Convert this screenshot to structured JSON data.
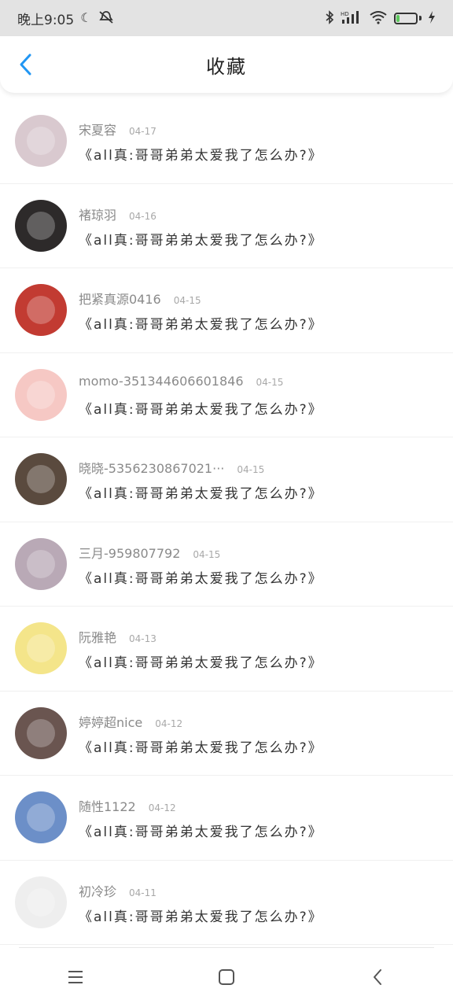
{
  "statusbar": {
    "time": "晚上9:05",
    "icons": [
      "moon-icon",
      "mute-icon",
      "bluetooth-icon",
      "hd-signal-icon",
      "wifi-icon",
      "battery-icon",
      "charging-icon"
    ],
    "battery_level": "16"
  },
  "header": {
    "title": "收藏",
    "back_icon": "chevron-left-icon"
  },
  "items": [
    {
      "name": "宋夏容",
      "date": "04-17",
      "snippet": "《all真:哥哥弟弟太爱我了怎么办?》",
      "avatar_color": "#d9c9cf"
    },
    {
      "name": "褚琼羽",
      "date": "04-16",
      "snippet": "《all真:哥哥弟弟太爱我了怎么办?》",
      "avatar_color": "#2d2a2a"
    },
    {
      "name": "把紧真源0416",
      "date": "04-15",
      "snippet": "《all真:哥哥弟弟太爱我了怎么办?》",
      "avatar_color": "#c23b32"
    },
    {
      "name": "momo-351344606601846",
      "date": "04-15",
      "snippet": "《all真:哥哥弟弟太爱我了怎么办?》",
      "avatar_color": "#f6c8c4"
    },
    {
      "name": "晓晓-5356230867021···",
      "date": "04-15",
      "snippet": "《all真:哥哥弟弟太爱我了怎么办?》",
      "avatar_color": "#5a4a3e"
    },
    {
      "name": "三月-959807792",
      "date": "04-15",
      "snippet": "《all真:哥哥弟弟太爱我了怎么办?》",
      "avatar_color": "#b9a9b6"
    },
    {
      "name": "阮雅艳",
      "date": "04-13",
      "snippet": "《all真:哥哥弟弟太爱我了怎么办?》",
      "avatar_color": "#f4e58a"
    },
    {
      "name": "婷婷超nice",
      "date": "04-12",
      "snippet": "《all真:哥哥弟弟太爱我了怎么办?》",
      "avatar_color": "#6a5550"
    },
    {
      "name": "随性1122",
      "date": "04-12",
      "snippet": "《all真:哥哥弟弟太爱我了怎么办?》",
      "avatar_color": "#6c8fc8"
    },
    {
      "name": "初冷珍",
      "date": "04-11",
      "snippet": "《all真:哥哥弟弟太爱我了怎么办?》",
      "avatar_color": "#eeeeee"
    }
  ],
  "navbar": {
    "buttons": [
      "menu-icon",
      "home-square-icon",
      "back-triangle-icon"
    ]
  }
}
